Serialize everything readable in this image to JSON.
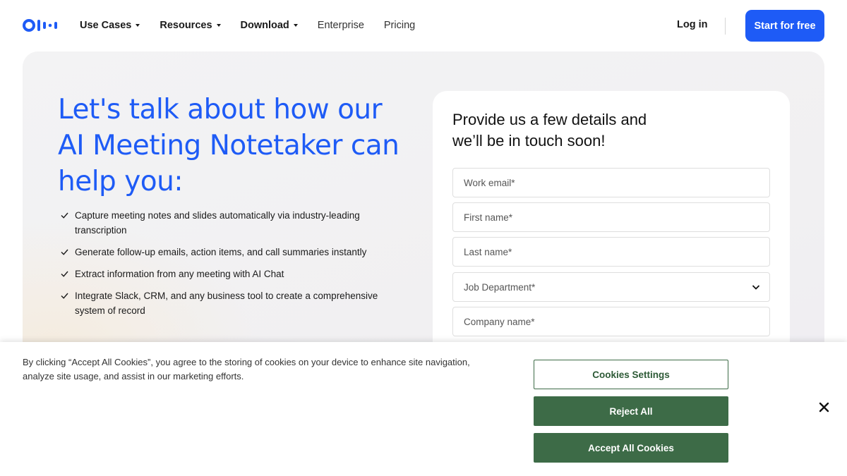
{
  "nav": {
    "items": [
      {
        "label": "Use Cases",
        "dropdown": true
      },
      {
        "label": "Resources",
        "dropdown": true
      },
      {
        "label": "Download",
        "dropdown": true
      },
      {
        "label": "Enterprise",
        "dropdown": false
      },
      {
        "label": "Pricing",
        "dropdown": false
      }
    ],
    "login_label": "Log in",
    "cta_label": "Start for free"
  },
  "hero": {
    "headline": "Let's talk about how our AI Meeting Notetaker can help you:",
    "benefits": [
      "Capture meeting notes and slides automatically via industry-leading transcription",
      "Generate follow-up emails, action items, and call summaries instantly",
      "Extract information from any meeting with AI Chat",
      "Integrate Slack, CRM, and any business tool to create a comprehensive system of record"
    ]
  },
  "form": {
    "title": "Provide us a few details and we’ll be in touch soon!",
    "fields": {
      "email_placeholder": "Work email*",
      "first_name_placeholder": "First name*",
      "last_name_placeholder": "Last name*",
      "department_placeholder": "Job Department*",
      "company_placeholder": "Company name*"
    }
  },
  "cookie_banner": {
    "text": "By clicking “Accept All Cookies”, you agree to the storing of cookies on your device to enhance site navigation, analyze site usage, and assist in our marketing efforts.",
    "settings_label": "Cookies Settings",
    "reject_label": "Reject All",
    "accept_label": "Accept All Cookies"
  },
  "colors": {
    "brand_blue": "#1e5bf6",
    "cookie_green": "#3d6b47"
  }
}
